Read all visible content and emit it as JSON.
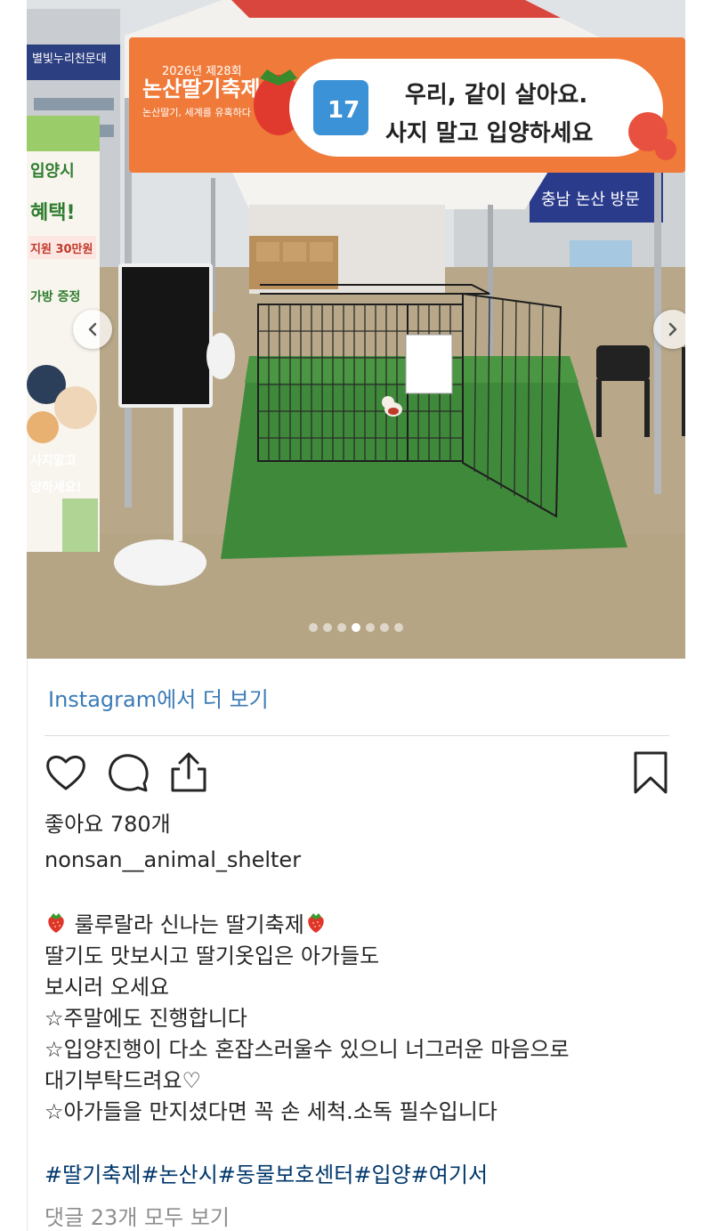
{
  "post": {
    "photo": {
      "banner_subtitle": "2026년 제28회",
      "banner_title": "논산딸기축제",
      "banner_tagline": "논산딸기, 세계를 유혹하다",
      "booth_number": "17",
      "banner_line1": "우리, 같이 살아요.",
      "banner_line2": "사지 말고 입양하세요",
      "left_sign_top": "별빛누리천문대",
      "left_banner_lines": [
        "입양시",
        "혜택!",
        "지원 30만원",
        "가방 증정",
        "사지말고",
        "양하세요!"
      ],
      "right_sign": "충남 논산 방문",
      "carousel_count": 7,
      "carousel_active_index": 3
    },
    "more_link": "Instagram에서 더 보기",
    "likes_text": "좋아요 780개",
    "username": "nonsan__animal_shelter",
    "caption": {
      "line1": "룰루랄라 신나는 딸기축제",
      "line2": "딸기도 맛보시고 딸기옷입은 아가들도",
      "line3": "보시러 오세요",
      "line4": "☆주말에도 진행합니다",
      "line5": "☆입양진행이 다소 혼잡스러울수 있으니 너그러운 마음으로",
      "line6": "대기부탁드려요♡",
      "line7": "☆아가들을 만지셨다면 꼭 손 세척.소독 필수입니다"
    },
    "hashtags": [
      "#딸기축제",
      "#논산시",
      "#동물보호센터",
      "#입양",
      "#여기서"
    ],
    "comments_link": "댓글 23개 모두 보기",
    "icons": {
      "like": "heart-icon",
      "comment": "comment-bubble-icon",
      "share": "share-icon",
      "save": "bookmark-icon",
      "prev": "chevron-left-icon",
      "next": "chevron-right-icon",
      "emoji": "strawberry-icon"
    },
    "colors": {
      "banner_orange": "#f07a3a",
      "link_blue": "#3b7bb7",
      "hashtag_blue": "#00376b",
      "turf_green": "#3f8a3a"
    }
  }
}
